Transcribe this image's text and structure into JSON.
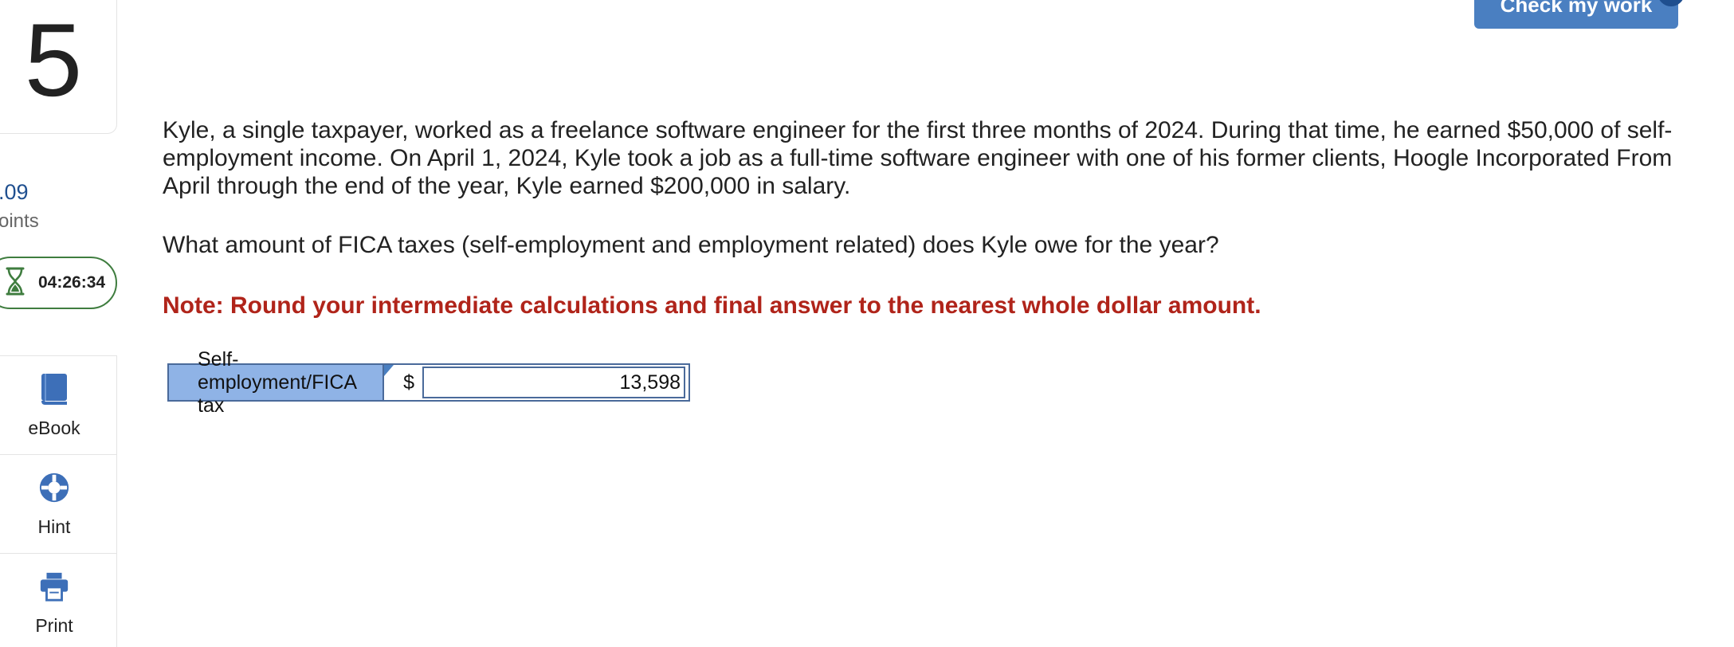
{
  "question_number": "5",
  "points": {
    "value": ".09",
    "label": "oints"
  },
  "timer": {
    "value": "04:26:34"
  },
  "tools": [
    {
      "label": "eBook",
      "icon": "book-icon"
    },
    {
      "label": "Hint",
      "icon": "lifebuoy-icon"
    },
    {
      "label": "Print",
      "icon": "printer-icon"
    }
  ],
  "check_button": {
    "label": "Check my work"
  },
  "question": {
    "text": "Kyle, a single taxpayer, worked as a freelance software engineer for the first three months of 2024. During that time, he earned $50,000 of self-employment income. On April 1, 2024, Kyle took a job as a full-time software engineer with one of his former clients, Hoogle Incorporated From April through the end of the year, Kyle earned $200,000 in salary.",
    "ask": "What amount of FICA taxes (self-employment and employment related) does Kyle owe for the year?",
    "note": "Note: Round your intermediate calculations and final answer to the nearest whole dollar amount."
  },
  "answer": {
    "label": "Self-employment/FICA tax",
    "currency": "$",
    "value": "13,598"
  },
  "colors": {
    "accent": "#4a7fc1",
    "note_red": "#b0241a",
    "timer_green": "#3f7d3f",
    "answer_label_bg": "#8fb3e6"
  }
}
